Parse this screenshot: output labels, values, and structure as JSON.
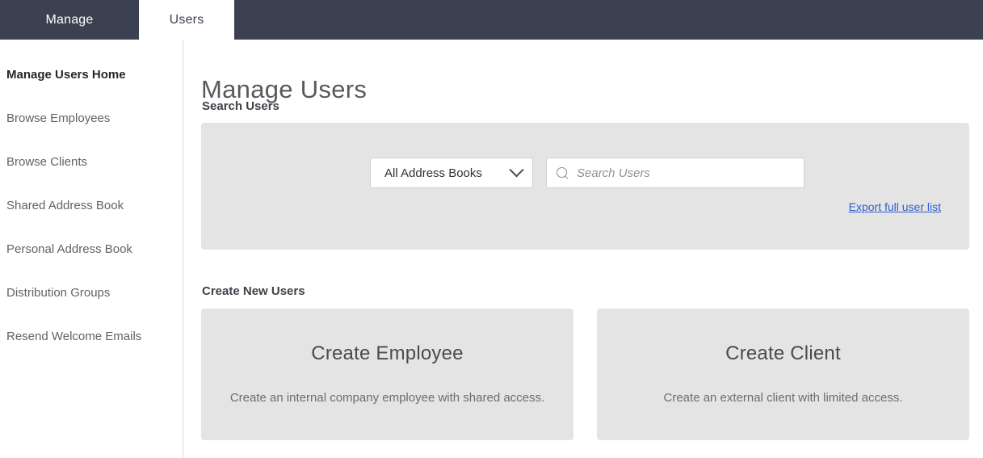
{
  "topbar": {
    "tabs": [
      {
        "label": "Manage",
        "active": false
      },
      {
        "label": "Users",
        "active": true
      }
    ]
  },
  "sidebar": {
    "items": [
      {
        "label": "Manage Users Home",
        "active": true
      },
      {
        "label": "Browse Employees",
        "active": false
      },
      {
        "label": "Browse Clients",
        "active": false
      },
      {
        "label": "Shared Address Book",
        "active": false
      },
      {
        "label": "Personal Address Book",
        "active": false
      },
      {
        "label": "Distribution Groups",
        "active": false
      },
      {
        "label": "Resend Welcome Emails",
        "active": false
      }
    ]
  },
  "main": {
    "page_title": "Manage Users",
    "search_section": {
      "label": "Search Users",
      "address_book_select": {
        "selected": "All Address Books",
        "chevron": "chevron-down-icon"
      },
      "search_input": {
        "value": "",
        "placeholder": "Search Users",
        "icon": "search-icon"
      },
      "export_link": "Export full user list"
    },
    "create_section": {
      "label": "Create New Users",
      "cards": [
        {
          "title": "Create Employee",
          "description": "Create an internal company employee with shared access."
        },
        {
          "title": "Create Client",
          "description": "Create an external client with limited access."
        }
      ]
    }
  },
  "colors": {
    "topbar_bg": "#3b4150",
    "panel_bg": "#e4e4e4",
    "link": "#2f5fd0",
    "page_bg": "#ffffff"
  }
}
